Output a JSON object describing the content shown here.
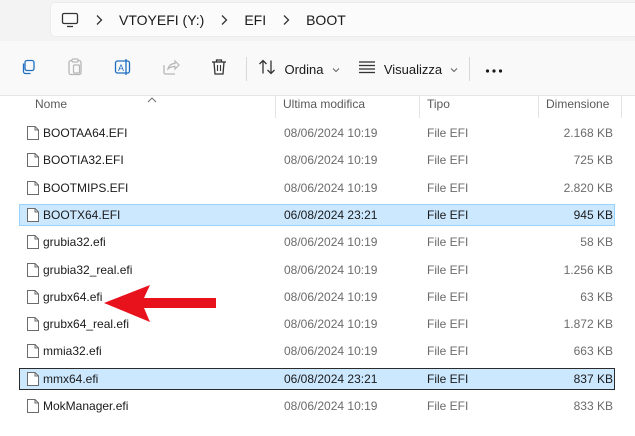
{
  "address": {
    "crumbs": [
      "VTOYEFI (Y:)",
      "EFI",
      "BOOT"
    ]
  },
  "toolbar": {
    "sort_label": "Ordina",
    "view_label": "Visualizza"
  },
  "columns": {
    "name": "Nome",
    "modified": "Ultima modifica",
    "type": "Tipo",
    "size": "Dimensione"
  },
  "files": [
    {
      "name": "BOOTAA64.EFI",
      "modified": "08/06/2024 10:19",
      "type": "File EFI",
      "size": "2.168 KB",
      "selected": false
    },
    {
      "name": "BOOTIA32.EFI",
      "modified": "08/06/2024 10:19",
      "type": "File EFI",
      "size": "725 KB",
      "selected": false
    },
    {
      "name": "BOOTMIPS.EFI",
      "modified": "08/06/2024 10:19",
      "type": "File EFI",
      "size": "2.820 KB",
      "selected": false
    },
    {
      "name": "BOOTX64.EFI",
      "modified": "06/08/2024 23:21",
      "type": "File EFI",
      "size": "945 KB",
      "selected": true
    },
    {
      "name": "grubia32.efi",
      "modified": "08/06/2024 10:19",
      "type": "File EFI",
      "size": "58 KB",
      "selected": false
    },
    {
      "name": "grubia32_real.efi",
      "modified": "08/06/2024 10:19",
      "type": "File EFI",
      "size": "1.256 KB",
      "selected": false
    },
    {
      "name": "grubx64.efi",
      "modified": "08/06/2024 10:19",
      "type": "File EFI",
      "size": "63 KB",
      "selected": false
    },
    {
      "name": "grubx64_real.efi",
      "modified": "08/06/2024 10:19",
      "type": "File EFI",
      "size": "1.872 KB",
      "selected": false
    },
    {
      "name": "mmia32.efi",
      "modified": "08/06/2024 10:19",
      "type": "File EFI",
      "size": "663 KB",
      "selected": false
    },
    {
      "name": "mmx64.efi",
      "modified": "06/08/2024 23:21",
      "type": "File EFI",
      "size": "837 KB",
      "selected": true
    },
    {
      "name": "MokManager.efi",
      "modified": "08/06/2024 10:19",
      "type": "File EFI",
      "size": "833 KB",
      "selected": false
    }
  ],
  "annotation": {
    "arrow_color": "#e8121c",
    "points_to": "grubx64.efi"
  },
  "colors": {
    "selection_bg": "#cce8ff",
    "selection_border": "#99d1ff",
    "accent_blue": "#1d6fc2"
  }
}
